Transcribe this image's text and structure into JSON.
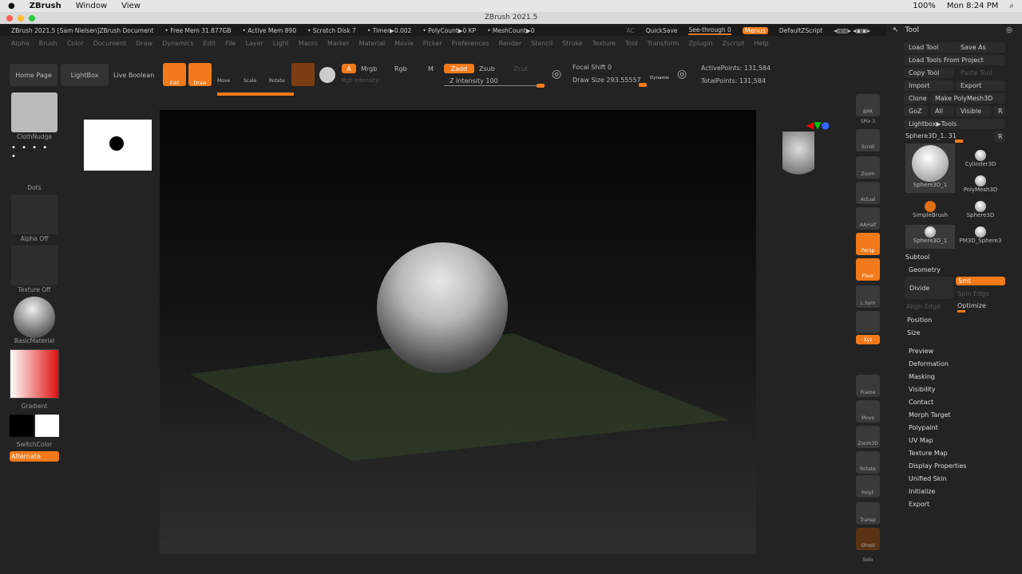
{
  "macbar": {
    "app": "ZBrush",
    "menus": [
      "Window",
      "View"
    ],
    "battery": "100%",
    "clock": "Mon 8:24 PM"
  },
  "window": {
    "title": "ZBrush 2021.5"
  },
  "info": {
    "doc": "ZBrush 2021.5 [Sam Nielsen]ZBrush Document",
    "free_mem": "• Free Mem 31.877GB",
    "active_mem": "• Active Mem 890",
    "scratch": "• Scratch Disk 7",
    "timer": "• Timer▶0.002",
    "polycount": "• PolyCount▶0 KP",
    "meshcount": "• MeshCount▶0",
    "ac": "AC",
    "quicksave": "QuickSave",
    "seethrough": "See-through  0",
    "menus_btn": "Menus",
    "script": "DefaultZScript"
  },
  "menus": [
    "Alpha",
    "Brush",
    "Color",
    "Document",
    "Draw",
    "Dynamics",
    "Edit",
    "File",
    "Layer",
    "Light",
    "Macro",
    "Marker",
    "Material",
    "Movie",
    "Picker",
    "Preferences",
    "Render",
    "Stencil",
    "Stroke",
    "Texture",
    "Tool",
    "Transform",
    "Zplugin",
    "Zscript",
    "Help"
  ],
  "toolbar": {
    "home": "Home Page",
    "lightbox": "LightBox",
    "live_boolean": "Live Boolean",
    "edit": "Edit",
    "draw": "Draw",
    "move": "Move",
    "scale": "Scale",
    "rotate": "Rotate",
    "a": "A",
    "mrgb": "Mrgb",
    "rgb": "Rgb",
    "m": "M",
    "rgb_intensity": "Rgb Intensity",
    "zadd": "Zadd",
    "zsub": "Zsub",
    "zcut": "Zcut",
    "z_intensity": "Z Intensity 100",
    "focal_shift": "Focal Shift 0",
    "draw_size": "Draw Size 293.55557",
    "dynamic": "Dynamic",
    "active_points": "ActivePoints: 131,584",
    "total_points": "TotalPoints: 131,584"
  },
  "shelf": {
    "brush": "ClothNudge",
    "stroke": "Dots",
    "alpha": "Alpha Off",
    "texture": "Texture Off",
    "material": "BasicMaterial",
    "gradient": "Gradient",
    "switchcolor": "SwitchColor",
    "alternate": "Alternate"
  },
  "nav": [
    "BPR",
    "SPix 3",
    "Scroll",
    "Zoom",
    "Actual",
    "AAHalf",
    "Persp",
    "Floor",
    "L.Sym",
    "",
    "Xyz",
    "",
    "",
    "Frame",
    "Move",
    "Zoom3D",
    "Rotate",
    "PolyF",
    "Transp",
    "Ghost",
    "Solo"
  ],
  "tool": {
    "title": "Tool",
    "load": "Load Tool",
    "save_as": "Save As",
    "load_project": "Load Tools From Project",
    "copy": "Copy Tool",
    "paste": "Paste Tool",
    "import": "Import",
    "export": "Export",
    "clone": "Clone",
    "make_polymesh": "Make PolyMesh3D",
    "goz": "GoZ",
    "all": "All",
    "visible": "Visible",
    "r": "R",
    "lightbox_tools": "Lightbox▶Tools",
    "current": "Sphere3D_1. 31",
    "thumbs": [
      "Sphere3D_1",
      "Cylinder3D",
      "PolyMesh3D",
      "SimpleBrush",
      "Sphere3D",
      "Sphere3D_1",
      "PM3D_Sphere3"
    ],
    "subtool": "Subtool",
    "geometry": "Geometry",
    "divide": "Divide",
    "smt": "Smt",
    "spin_edge": "Spin Edge",
    "align_edge": "Align Edge",
    "optimize": "Optimize",
    "position": "Position",
    "size": "Size",
    "sections": [
      "Preview",
      "Deformation",
      "Masking",
      "Visibility",
      "Contact",
      "Morph Target",
      "Polypaint",
      "UV Map",
      "Texture Map",
      "Display Properties",
      "Unified Skin",
      "Initialize",
      "Export"
    ]
  },
  "colors": {
    "accent": "#f27a1a"
  }
}
